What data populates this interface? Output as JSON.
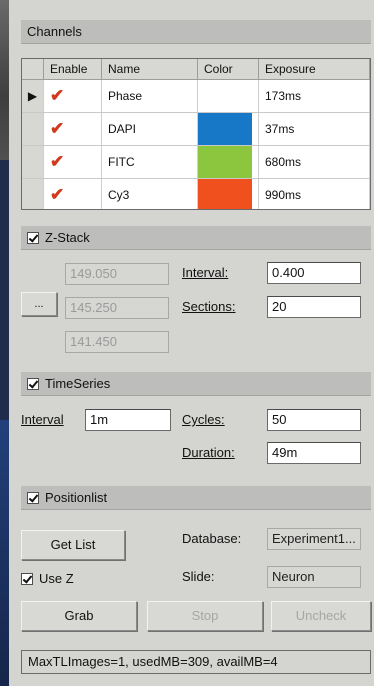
{
  "channels": {
    "header": "Channels",
    "columns": [
      "Enable",
      "Name",
      "Color",
      "Exposure"
    ],
    "rows": [
      {
        "marker": "▶",
        "name": "Phase",
        "color": "#ffffff",
        "exposure": "173ms"
      },
      {
        "marker": "",
        "name": "DAPI",
        "color": "#1878c8",
        "exposure": "37ms"
      },
      {
        "marker": "",
        "name": "FITC",
        "color": "#8cc63e",
        "exposure": "680ms"
      },
      {
        "marker": "",
        "name": "Cy3",
        "color": "#f0501e",
        "exposure": "990ms"
      }
    ]
  },
  "zstack": {
    "header": "Z-Stack",
    "pos_top": "149.050",
    "pos_mid": "145.250",
    "pos_bottom": "141.450",
    "side_button": "...",
    "interval_label": "Interval:",
    "interval_value": "0.400",
    "sections_label": "Sections:",
    "sections_value": "20"
  },
  "timeseries": {
    "header": "TimeSeries",
    "interval_label": "Interval",
    "interval_value": "1m",
    "cycles_label": "Cycles:",
    "cycles_value": "50",
    "duration_label": "Duration:",
    "duration_value": "49m"
  },
  "positionlist": {
    "header": "Positionlist",
    "get_list": "Get List",
    "database_label": "Database:",
    "database_value": "Experiment1...",
    "use_z": "Use Z",
    "slide_label": "Slide:",
    "slide_value": "Neuron"
  },
  "actions": {
    "grab": "Grab",
    "stop": "Stop",
    "uncheck": "Uncheck"
  },
  "status": "MaxTLImages=1, usedMB=309, availMB=4",
  "colors": {
    "panel": "#d4d4d1",
    "header": "#bdbdbb",
    "check": "#d23a1e"
  }
}
